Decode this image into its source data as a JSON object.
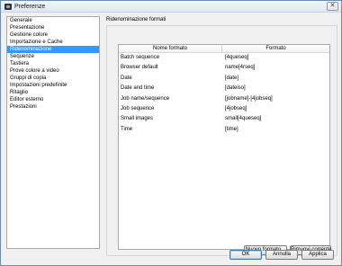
{
  "window": {
    "title": "Preferenze",
    "close_glyph": "✕"
  },
  "sidebar": {
    "items": [
      {
        "label": "Generale"
      },
      {
        "label": "Presentazione"
      },
      {
        "label": "Gestione colore"
      },
      {
        "label": "Importazione e Cache"
      },
      {
        "label": "Ridenominazione",
        "selected": true
      },
      {
        "label": "Sequenze"
      },
      {
        "label": "Tastiera"
      },
      {
        "label": "Prove colore a video"
      },
      {
        "label": "Gruppi di copia"
      },
      {
        "label": "Impostazioni predefinite"
      },
      {
        "label": "Ritaglio"
      },
      {
        "label": "Editor esterno"
      },
      {
        "label": "Prestazioni"
      }
    ]
  },
  "main": {
    "section_title": "Ridenominazione formati",
    "table": {
      "columns": [
        "Nome formato",
        "Formato"
      ],
      "rows": [
        {
          "name": "Batch sequence",
          "format": "[4queseq]"
        },
        {
          "name": "Browser default",
          "format": "name[4rseq]"
        },
        {
          "name": "Date",
          "format": "[date]"
        },
        {
          "name": "Date and time",
          "format": "[dateiso]"
        },
        {
          "name": "Job name/sequence",
          "format": "[jobname]-[4jobseq]"
        },
        {
          "name": "Job sequence",
          "format": "[4jobseq]"
        },
        {
          "name": "Small images",
          "format": "small[4queseq]"
        },
        {
          "name": "Time",
          "format": "[time]"
        }
      ]
    },
    "buttons": {
      "new_format": "Nuovo formato...",
      "remove": "Rimuovi corrente"
    }
  },
  "footer": {
    "ok": "OK",
    "cancel": "Annulla",
    "apply": "Applica"
  }
}
